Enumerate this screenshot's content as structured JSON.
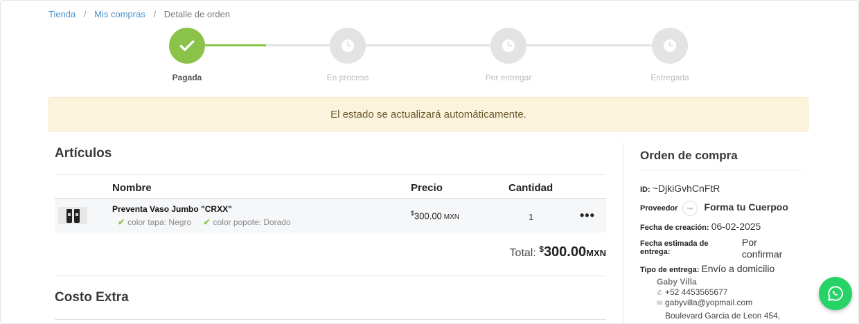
{
  "breadcrumb": {
    "items": [
      "Tienda",
      "Mis compras",
      "Detalle de orden"
    ],
    "separator": "/"
  },
  "stepper": {
    "steps": [
      {
        "label": "Pagada",
        "state": "done",
        "icon": "check-icon"
      },
      {
        "label": "En proceso",
        "state": "pending",
        "icon": "clock-icon"
      },
      {
        "label": "Por entregar",
        "state": "pending",
        "icon": "clock-icon"
      },
      {
        "label": "Entregada",
        "state": "pending",
        "icon": "clock-icon"
      }
    ],
    "progress_fraction": 0.17
  },
  "alert": {
    "text": "El estado se actualizará automáticamente."
  },
  "articles": {
    "title": "Artículos",
    "headers": {
      "name": "Nombre",
      "price": "Precio",
      "qty": "Cantidad"
    },
    "items": [
      {
        "name": "Preventa Vaso Jumbo \"CRXX\"",
        "variants": [
          "color tapa: Negro",
          "color popote: Dorado"
        ],
        "price_symbol": "$",
        "price": "300.00",
        "currency": "MXN",
        "qty": "1",
        "menu": "•••"
      }
    ],
    "total_label": "Total:",
    "total_symbol": "$",
    "total_amount": "300.00",
    "total_currency": "MXN"
  },
  "extra_cost": {
    "title": "Costo Extra"
  },
  "order": {
    "title": "Orden de compra",
    "id_label": "ID:",
    "id_value": "~DjkiGvhCnFtR",
    "provider_label": "Proveedor",
    "provider_name": "Forma tu Cuerpoo",
    "created_label": "Fecha de creación:",
    "created_value": "06-02-2025",
    "estimated_label": "Fecha estimada de entrega:",
    "estimated_value": "Por confirmar",
    "delivery_label": "Tipo de entrega:",
    "delivery_value": "Envío a domicilio",
    "contact": {
      "name": "Gaby Villa",
      "phone": "+52 4453565677",
      "email": "gabyvilla@yopmail.com",
      "address": "Boulevard Garcia de Leon 454,"
    }
  },
  "colors": {
    "accent_green": "#8bc34a",
    "link_blue": "#4a90c9",
    "alert_bg": "#fcf3dc",
    "whatsapp": "#25d366"
  }
}
